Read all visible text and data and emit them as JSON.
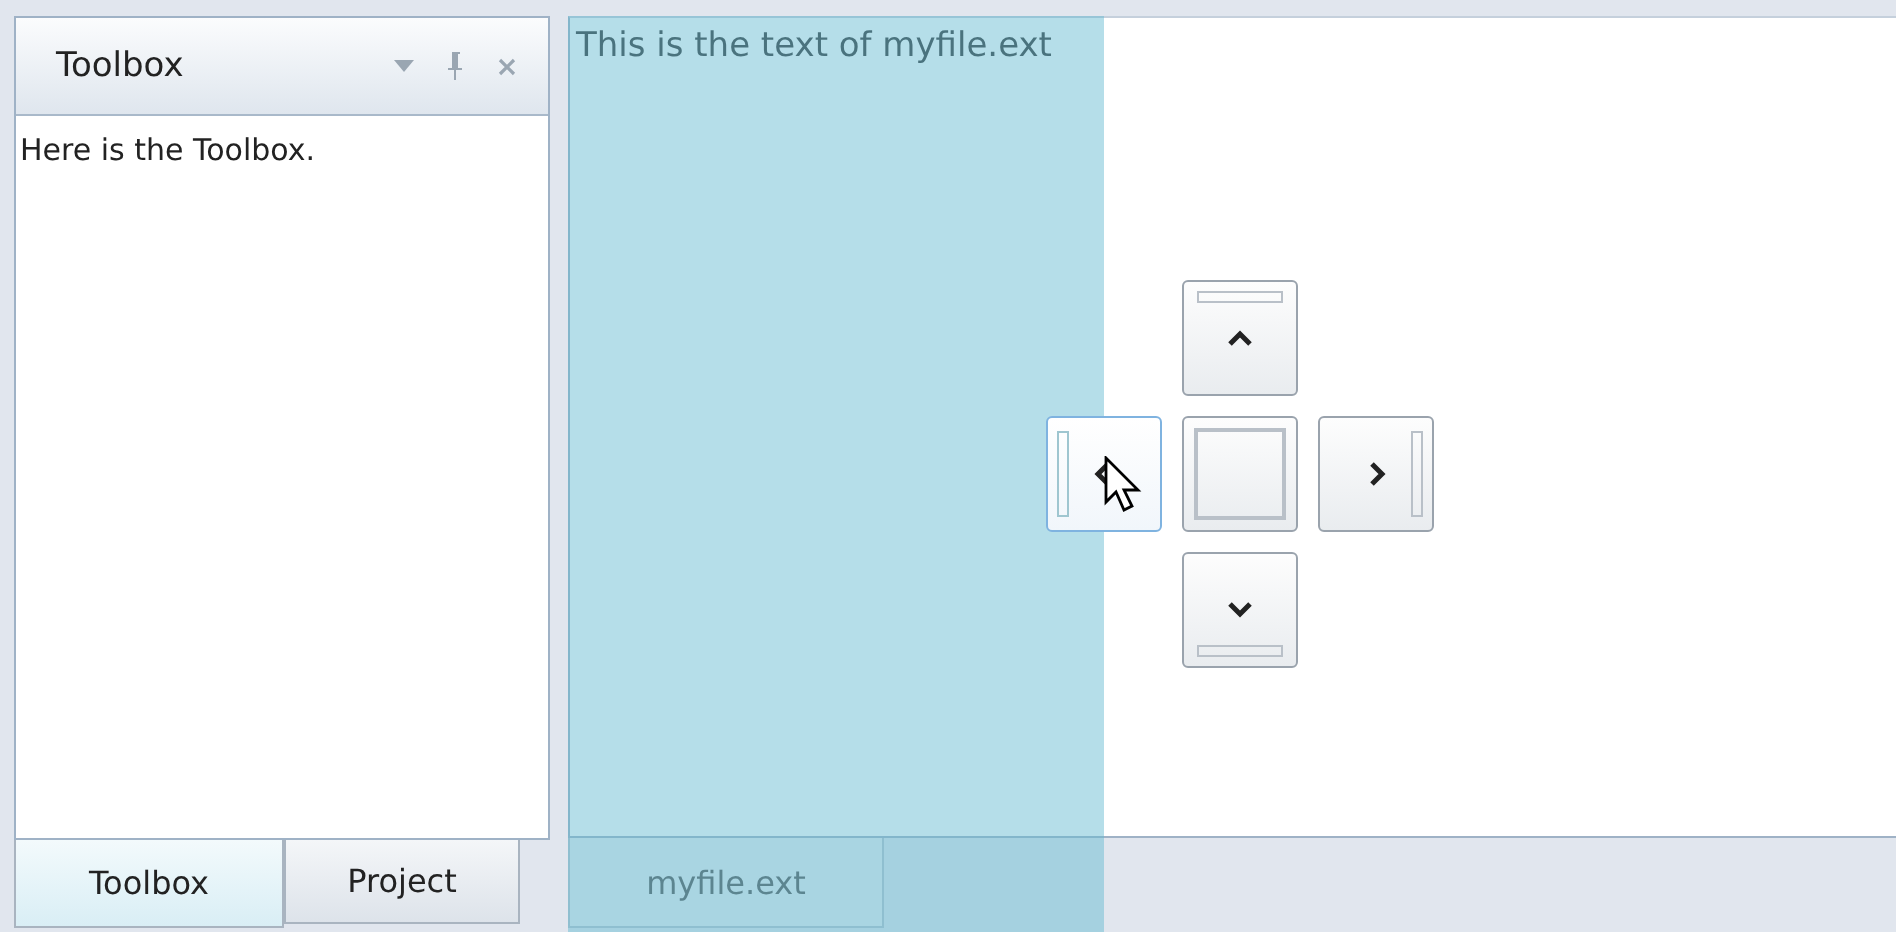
{
  "tool_pane": {
    "title": "Toolbox",
    "body": "Here is the Toolbox.",
    "tabs": [
      {
        "label": "Toolbox",
        "selected": true
      },
      {
        "label": "Project",
        "selected": false
      }
    ]
  },
  "document": {
    "text": "This is the text of myfile.ext",
    "tabs": [
      {
        "label": "myfile.ext"
      }
    ]
  },
  "dock_guide": [
    {
      "kind": "top",
      "highlighted": false
    },
    {
      "kind": "left",
      "highlighted": true
    },
    {
      "kind": "center",
      "highlighted": false
    },
    {
      "kind": "right",
      "highlighted": false
    },
    {
      "kind": "bottom",
      "highlighted": false
    }
  ]
}
